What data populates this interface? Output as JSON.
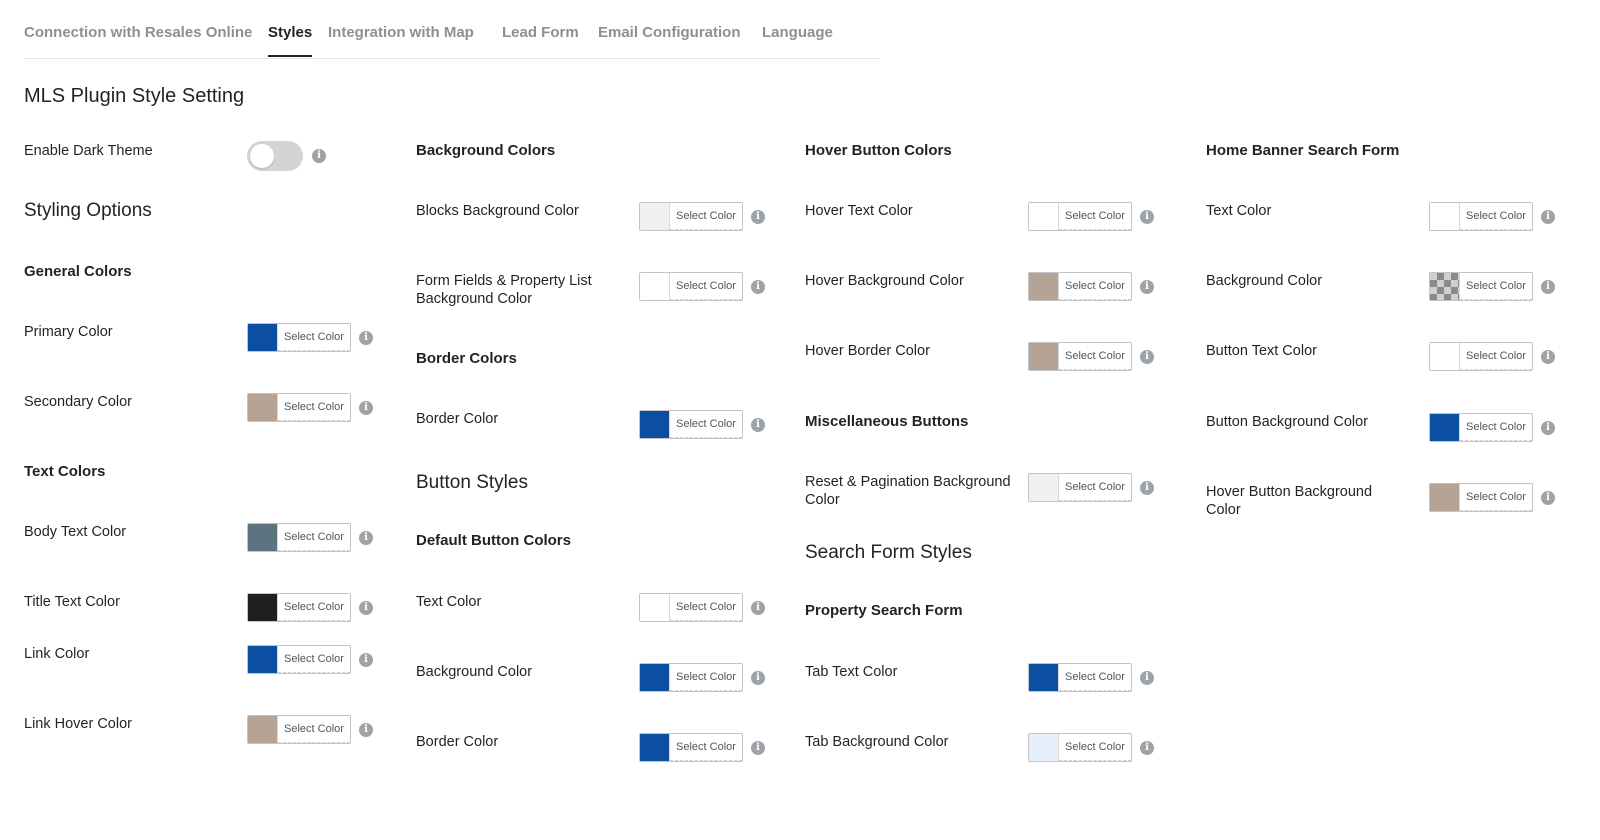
{
  "tabs": [
    {
      "label": "Connection with Resales Online",
      "active": false
    },
    {
      "label": "Styles",
      "active": true
    },
    {
      "label": "Integration with Map",
      "active": false
    },
    {
      "label": "Lead Form",
      "active": false
    },
    {
      "label": "Email Configuration",
      "active": false
    },
    {
      "label": "Language",
      "active": false
    }
  ],
  "page_title": "MLS Plugin Style Setting",
  "dark_theme": {
    "label": "Enable Dark Theme",
    "enabled": false
  },
  "picker_text": "Select Color",
  "info_glyph": "i",
  "colors": {
    "blue": "#0b4ea2",
    "taupe": "#b5a395",
    "slate": "#5d7380",
    "dark": "#1f1f1f",
    "white": "#ffffff",
    "light_gray": "#f0f0f0",
    "light_blue": "#e6f0fb"
  },
  "col1": {
    "section_title": "Styling Options",
    "general_title": "General Colors",
    "primary": "Primary Color",
    "secondary": "Secondary Color",
    "text_title": "Text Colors",
    "body_text": "Body Text Color",
    "title_text": "Title Text Color",
    "link": "Link Color",
    "link_hover": "Link Hover Color"
  },
  "col2": {
    "bg_title": "Background Colors",
    "blocks_bg": "Blocks Background Color",
    "form_fields_bg": "Form Fields & Property List Background Color",
    "border_title": "Border Colors",
    "border": "Border Color",
    "button_styles": "Button Styles",
    "default_btn_title": "Default Button Colors",
    "text": "Text Color",
    "background": "Background Color",
    "btn_border": "Border Color"
  },
  "col3": {
    "hover_title": "Hover Button Colors",
    "hover_text": "Hover Text Color",
    "hover_bg": "Hover Background Color",
    "hover_border": "Hover Border Color",
    "misc_title": "Miscellaneous Buttons",
    "reset_bg": "Reset & Pagination Background Color",
    "search_styles": "Search Form Styles",
    "property_search_title": "Property Search Form",
    "tab_text": "Tab Text Color",
    "tab_bg": "Tab Background Color"
  },
  "col4": {
    "banner_title": "Home Banner Search Form",
    "text": "Text Color",
    "background": "Background Color",
    "button_text": "Button Text Color",
    "button_bg": "Button Background Color",
    "hover_button_bg": "Hover Button Background Color"
  }
}
